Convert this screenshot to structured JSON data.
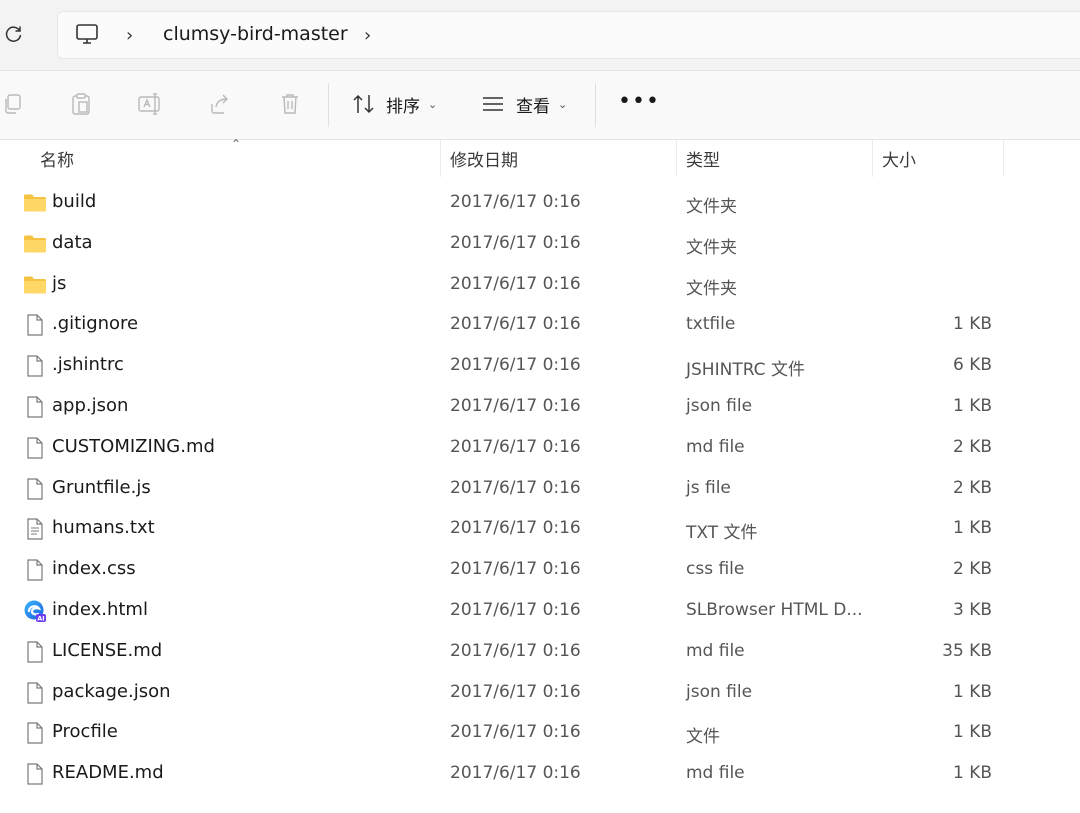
{
  "address": {
    "crumbs": [
      "clumsy-bird-master"
    ]
  },
  "toolbar": {
    "sort_label": "排序",
    "view_label": "查看",
    "more_label": "•••"
  },
  "columns": {
    "name": "名称",
    "modified": "修改日期",
    "type": "类型",
    "size": "大小"
  },
  "files": [
    {
      "name": "build",
      "modified": "2017/6/17 0:16",
      "type": "文件夹",
      "size": "",
      "icon": "folder-icon"
    },
    {
      "name": "data",
      "modified": "2017/6/17 0:16",
      "type": "文件夹",
      "size": "",
      "icon": "folder-icon"
    },
    {
      "name": "js",
      "modified": "2017/6/17 0:16",
      "type": "文件夹",
      "size": "",
      "icon": "folder-icon"
    },
    {
      "name": ".gitignore",
      "modified": "2017/6/17 0:16",
      "type": "txtfile",
      "size": "1 KB",
      "icon": "file-icon"
    },
    {
      "name": ".jshintrc",
      "modified": "2017/6/17 0:16",
      "type": "JSHINTRC 文件",
      "size": "6 KB",
      "icon": "file-icon"
    },
    {
      "name": "app.json",
      "modified": "2017/6/17 0:16",
      "type": "json file",
      "size": "1 KB",
      "icon": "file-icon"
    },
    {
      "name": "CUSTOMIZING.md",
      "modified": "2017/6/17 0:16",
      "type": "md file",
      "size": "2 KB",
      "icon": "file-icon"
    },
    {
      "name": "Gruntfile.js",
      "modified": "2017/6/17 0:16",
      "type": "js file",
      "size": "2 KB",
      "icon": "file-icon"
    },
    {
      "name": "humans.txt",
      "modified": "2017/6/17 0:16",
      "type": "TXT 文件",
      "size": "1 KB",
      "icon": "text-file-icon"
    },
    {
      "name": "index.css",
      "modified": "2017/6/17 0:16",
      "type": "css file",
      "size": "2 KB",
      "icon": "file-icon"
    },
    {
      "name": "index.html",
      "modified": "2017/6/17 0:16",
      "type": "SLBrowser HTML D...",
      "size": "3 KB",
      "icon": "browser-html-icon"
    },
    {
      "name": "LICENSE.md",
      "modified": "2017/6/17 0:16",
      "type": "md file",
      "size": "35 KB",
      "icon": "file-icon"
    },
    {
      "name": "package.json",
      "modified": "2017/6/17 0:16",
      "type": "json file",
      "size": "1 KB",
      "icon": "file-icon"
    },
    {
      "name": "Procfile",
      "modified": "2017/6/17 0:16",
      "type": "文件",
      "size": "1 KB",
      "icon": "file-icon"
    },
    {
      "name": "README.md",
      "modified": "2017/6/17 0:16",
      "type": "md file",
      "size": "1 KB",
      "icon": "file-icon"
    }
  ]
}
